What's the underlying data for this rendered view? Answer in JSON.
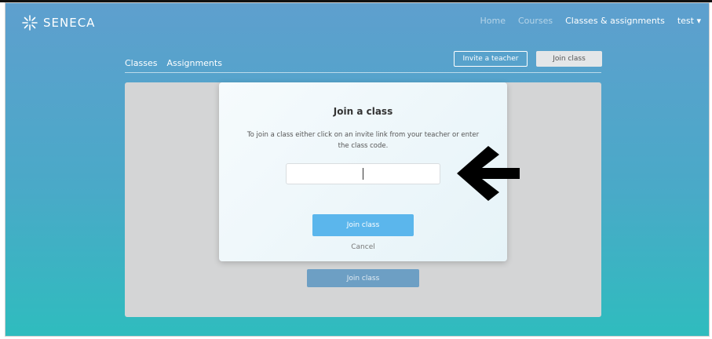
{
  "app": {
    "logo_text": "SENECA"
  },
  "nav": {
    "items": [
      {
        "label": "Home"
      },
      {
        "label": "Courses"
      },
      {
        "label": "Classes & assignments"
      },
      {
        "label": "test ▾"
      }
    ]
  },
  "tabs": [
    {
      "label": "Classes"
    },
    {
      "label": "Assignments"
    }
  ],
  "header_buttons": {
    "invite_label": "Invite a teacher",
    "join_label": "Join class"
  },
  "background": {
    "join_label": "Join class"
  },
  "modal": {
    "title": "Join a class",
    "description": "To join a class either click on an invite link from your teacher or enter the class code.",
    "input_value": "",
    "input_placeholder": "",
    "join_label": "Join class",
    "cancel_label": "Cancel"
  },
  "colors": {
    "accent": "#5bb6ec",
    "background_top": "#5e9fce",
    "background_bottom": "#2fbcbe"
  },
  "icons": {
    "logo": "seneca-star-icon",
    "annotation": "left-arrow-icon"
  }
}
